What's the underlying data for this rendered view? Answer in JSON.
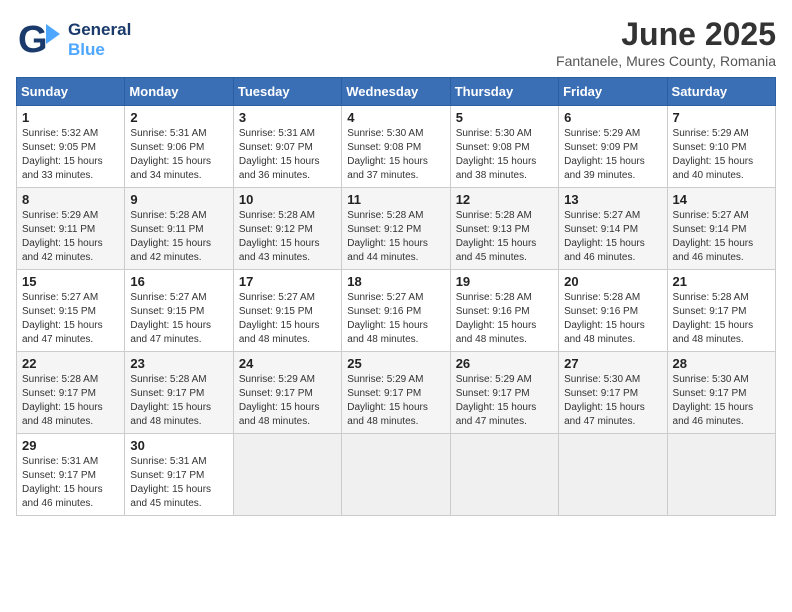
{
  "logo": {
    "line1": "General",
    "line2": "Blue"
  },
  "title": "June 2025",
  "subtitle": "Fantanele, Mures County, Romania",
  "weekdays": [
    "Sunday",
    "Monday",
    "Tuesday",
    "Wednesday",
    "Thursday",
    "Friday",
    "Saturday"
  ],
  "weeks": [
    [
      {
        "day": 1,
        "sunrise": "5:32 AM",
        "sunset": "9:05 PM",
        "daylight": "15 hours and 33 minutes."
      },
      {
        "day": 2,
        "sunrise": "5:31 AM",
        "sunset": "9:06 PM",
        "daylight": "15 hours and 34 minutes."
      },
      {
        "day": 3,
        "sunrise": "5:31 AM",
        "sunset": "9:07 PM",
        "daylight": "15 hours and 36 minutes."
      },
      {
        "day": 4,
        "sunrise": "5:30 AM",
        "sunset": "9:08 PM",
        "daylight": "15 hours and 37 minutes."
      },
      {
        "day": 5,
        "sunrise": "5:30 AM",
        "sunset": "9:08 PM",
        "daylight": "15 hours and 38 minutes."
      },
      {
        "day": 6,
        "sunrise": "5:29 AM",
        "sunset": "9:09 PM",
        "daylight": "15 hours and 39 minutes."
      },
      {
        "day": 7,
        "sunrise": "5:29 AM",
        "sunset": "9:10 PM",
        "daylight": "15 hours and 40 minutes."
      }
    ],
    [
      {
        "day": 8,
        "sunrise": "5:29 AM",
        "sunset": "9:11 PM",
        "daylight": "15 hours and 42 minutes."
      },
      {
        "day": 9,
        "sunrise": "5:28 AM",
        "sunset": "9:11 PM",
        "daylight": "15 hours and 42 minutes."
      },
      {
        "day": 10,
        "sunrise": "5:28 AM",
        "sunset": "9:12 PM",
        "daylight": "15 hours and 43 minutes."
      },
      {
        "day": 11,
        "sunrise": "5:28 AM",
        "sunset": "9:12 PM",
        "daylight": "15 hours and 44 minutes."
      },
      {
        "day": 12,
        "sunrise": "5:28 AM",
        "sunset": "9:13 PM",
        "daylight": "15 hours and 45 minutes."
      },
      {
        "day": 13,
        "sunrise": "5:27 AM",
        "sunset": "9:14 PM",
        "daylight": "15 hours and 46 minutes."
      },
      {
        "day": 14,
        "sunrise": "5:27 AM",
        "sunset": "9:14 PM",
        "daylight": "15 hours and 46 minutes."
      }
    ],
    [
      {
        "day": 15,
        "sunrise": "5:27 AM",
        "sunset": "9:15 PM",
        "daylight": "15 hours and 47 minutes."
      },
      {
        "day": 16,
        "sunrise": "5:27 AM",
        "sunset": "9:15 PM",
        "daylight": "15 hours and 47 minutes."
      },
      {
        "day": 17,
        "sunrise": "5:27 AM",
        "sunset": "9:15 PM",
        "daylight": "15 hours and 48 minutes."
      },
      {
        "day": 18,
        "sunrise": "5:27 AM",
        "sunset": "9:16 PM",
        "daylight": "15 hours and 48 minutes."
      },
      {
        "day": 19,
        "sunrise": "5:28 AM",
        "sunset": "9:16 PM",
        "daylight": "15 hours and 48 minutes."
      },
      {
        "day": 20,
        "sunrise": "5:28 AM",
        "sunset": "9:16 PM",
        "daylight": "15 hours and 48 minutes."
      },
      {
        "day": 21,
        "sunrise": "5:28 AM",
        "sunset": "9:17 PM",
        "daylight": "15 hours and 48 minutes."
      }
    ],
    [
      {
        "day": 22,
        "sunrise": "5:28 AM",
        "sunset": "9:17 PM",
        "daylight": "15 hours and 48 minutes."
      },
      {
        "day": 23,
        "sunrise": "5:28 AM",
        "sunset": "9:17 PM",
        "daylight": "15 hours and 48 minutes."
      },
      {
        "day": 24,
        "sunrise": "5:29 AM",
        "sunset": "9:17 PM",
        "daylight": "15 hours and 48 minutes."
      },
      {
        "day": 25,
        "sunrise": "5:29 AM",
        "sunset": "9:17 PM",
        "daylight": "15 hours and 48 minutes."
      },
      {
        "day": 26,
        "sunrise": "5:29 AM",
        "sunset": "9:17 PM",
        "daylight": "15 hours and 47 minutes."
      },
      {
        "day": 27,
        "sunrise": "5:30 AM",
        "sunset": "9:17 PM",
        "daylight": "15 hours and 47 minutes."
      },
      {
        "day": 28,
        "sunrise": "5:30 AM",
        "sunset": "9:17 PM",
        "daylight": "15 hours and 46 minutes."
      }
    ],
    [
      {
        "day": 29,
        "sunrise": "5:31 AM",
        "sunset": "9:17 PM",
        "daylight": "15 hours and 46 minutes."
      },
      {
        "day": 30,
        "sunrise": "5:31 AM",
        "sunset": "9:17 PM",
        "daylight": "15 hours and 45 minutes."
      },
      null,
      null,
      null,
      null,
      null
    ]
  ]
}
